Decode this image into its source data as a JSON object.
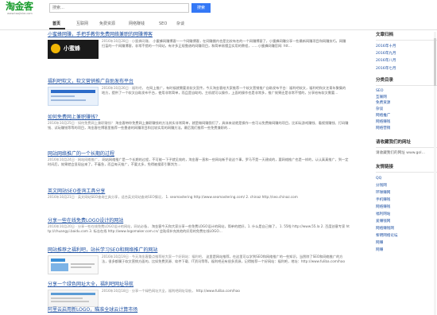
{
  "header": {
    "logo_text": "淘金客",
    "logo_subtext": "www.taojinke.com",
    "search_placeholder": "搜索…",
    "search_button": "搜索"
  },
  "nav": {
    "items": [
      {
        "label": "首页",
        "active": true
      },
      {
        "label": "互联网"
      },
      {
        "label": "免费资源"
      },
      {
        "label": "网络赚钱"
      },
      {
        "label": "SEO"
      },
      {
        "label": "杂谈"
      }
    ]
  },
  "posts": [
    {
      "title": "小蜜蜂网赚，手把手教你免费网络兼职的网赚博客",
      "meta": "2016年10月28日 · 小蜜蜂网赚，",
      "text": "小蜜蜂网赚博客—一个网赚博客，在网赚圈内也是比较有名的一个网赚博客了，小蜜蜂网赚分享一些最新网赚项目和网赚技巧，网赚扫盲的一个网赚博客，非常不错的一个网站，有许多正规靠谱的网赚项目，和简单易懂且实用的教程，……小蜜蜂网赚官网: htt…",
      "thumb_label": "小蜜蜂"
    },
    {
      "title": "福利吧软文，软文营销推广自助发布平台",
      "meta": "2016年10月26日 · 福利吧，",
      "text": "在网上推广，有时候就需要发软文宣传，今天淘金客给大家推荐一个软文营销推广自助发布平台：福利吧软文，福利吧和文艺青年聚集的地方，提供了一个软文自助发布平台，使用非常简单，而且是自助的，主机就可以操作，上面的操作也是非常多，推广效果还是非常不错的，分享给有软文需要…"
    },
    {
      "title": "如何免费网上兼职赚钱？",
      "meta": "2016年10月25日 · 如何免费网上兼职赚钱？",
      "text": "淘金客带你免费网上兼职赚钱的方法其实非常简单，就是做网赚我们了，具体来说就是操作一些可以免费做网赚的项目，比如玩游戏赚钱、看视频赚钱、打码赚钱、试玩赚钱等等的项目，淘金客在博客里推荐一些靠谱的网赚项目和比较实用的网赚方法。最后我们推荐一些免费兼职的…"
    },
    {
      "title": "网站网络推广的一个长期的过程",
      "meta": "2016年10月24日 · 网站网络推广，",
      "text": "网站网络推广是一个长期的过程，不可能一下子就见效的，淘金客一直和一些网站新手说这个事，罗马不是一天建成的，要网络推广也是一样的，认认真真推广，到一定时间后，效果就会显现出来了，不着急，而且每天推广，不要太多，免得被搜索引擎判为…"
    },
    {
      "title": "英文网站SEO查询工具分享",
      "meta": "2016年10月21日 · 英文网站SEO查询工具分享，适合英文网站查询SEO情况，",
      "text": "1. seomastering http://www.seomastering.com/ 2. chinaz http://seo.chinaz.com"
    },
    {
      "title": "分享一些在线免费LOGO设计的网站",
      "meta": "2016年10月20日 · 分享一些在线免费LOGO设计的网站，网站必备，",
      "text": "淘金客今天和大家分享一些免费LOGO设计的网站，简单的就好，1. 什么是自己做了， 1. 55啦 http://www.55.la 2. 百度创意专家 http://chuangyi.baidu.com 3. 标志在线 http://www.logomaker.com.cn/ 会陆续补充其他的好用的免费在线LOGO…"
    },
    {
      "title": "网站推荐之福利吧，站长学习SEO和网络推广的网站",
      "meta": "2016年10月19日 · 今天淘金客重点推荐给大家一个好网站：福利吧，",
      "text": "这里是网站推荐，在这里可以学到SEO和网络推广的一些知识，当然除了SEO和网络推广的方法，很多都属于软文营销方面的，比如免费资源、软件下载、IT资讯等等，福利吧还有很多资源，记得推荐一个好网站：福利吧，地址：http://www.fuliba.com/hao"
    },
    {
      "title": "分享一个绿色网址大全，福利吧网址导航",
      "meta": "2016年10月18日 · 分享一个绿色网址大全，福利吧网址导航，",
      "text": "http://www.fuliba.com/hao"
    },
    {
      "title": "阿里云启用新LOGO，瞄准全球云计算市场",
      "meta": "",
      "text": ""
    }
  ],
  "sidebar": {
    "archive_title": "文章归档",
    "archive_items": [
      "2016年十月",
      "2016年九月",
      "2016年八月",
      "2016年七月"
    ],
    "category_title": "分类目录",
    "category_items": [
      "SEO",
      "互联网",
      "免费资源",
      "杂谈",
      "网络推广",
      "网络赚钱",
      "网络营销"
    ],
    "follow_title": "请收藏我们的网址",
    "follow_text": "请收藏我们的网址 www.gol…",
    "links_title": "友情链接",
    "link_items": [
      "QQ",
      "分钱网",
      "环球赚网",
      "手机赚钱",
      "网络赚钱",
      "福利网站",
      "爱赚钱网",
      "网络赚钱网",
      "黎明网络论坛",
      "网赚",
      "网赚"
    ]
  }
}
